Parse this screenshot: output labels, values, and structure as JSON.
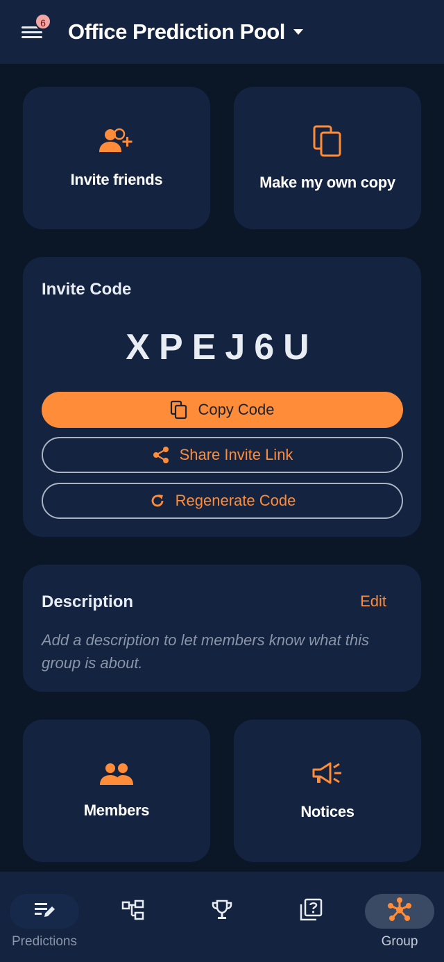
{
  "header": {
    "notification_count": "6",
    "title": "Office Prediction Pool",
    "icons": {
      "menu": "menu-icon",
      "dropdown": "caret-down-icon"
    }
  },
  "actions": {
    "invite_friends": "Invite friends",
    "make_copy": "Make my own copy"
  },
  "invite": {
    "heading": "Invite Code",
    "code": "XPEJ6U",
    "copy_label": "Copy Code",
    "share_label": "Share Invite Link",
    "regenerate_label": "Regenerate Code"
  },
  "description": {
    "heading": "Description",
    "edit_label": "Edit",
    "placeholder": "Add a description to let members know what this group is about."
  },
  "sections": {
    "members": "Members",
    "notices": "Notices"
  },
  "nav": {
    "items": [
      {
        "label": "Predictions",
        "icon": "predictions-icon"
      },
      {
        "label": "",
        "icon": "bracket-icon"
      },
      {
        "label": "",
        "icon": "trophy-icon"
      },
      {
        "label": "",
        "icon": "quiz-icon"
      },
      {
        "label": "Group",
        "icon": "group-icon"
      }
    ],
    "active": "Group"
  },
  "colors": {
    "accent": "#ff8c38",
    "background": "#0b1627",
    "surface": "#142340",
    "muted": "#8a95a8"
  }
}
